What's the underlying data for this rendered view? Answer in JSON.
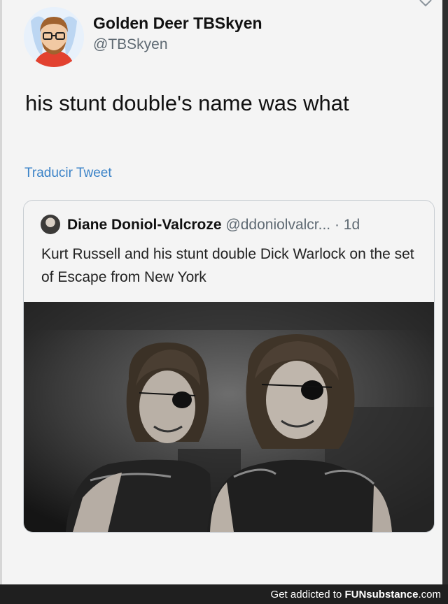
{
  "tweet": {
    "author_name": "Golden Deer TBSkyen",
    "author_handle": "@TBSkyen",
    "text": "his stunt double's name was what",
    "translate_label": "Traducir Tweet",
    "avatar_icon": "cartoon-avatar-icon",
    "menu_icon": "chevron-down-icon"
  },
  "quoted": {
    "author_name": "Diane Doniol-Valcroze",
    "author_handle": "@ddoniolvalcr...",
    "time": "· 1d",
    "text": "Kurt Russell and his stunt double Dick Warlock on the set of Escape from New York",
    "photo": "black-and-white-photo-two-men-eyepatch"
  },
  "footer": {
    "prefix": "Get addicted to ",
    "brand_fun": "FUN",
    "brand_sub": "substance",
    "brand_com": ".com"
  },
  "colors": {
    "link": "#3a82c7",
    "background": "#f4f4f4",
    "footer": "#1f1f1f"
  }
}
